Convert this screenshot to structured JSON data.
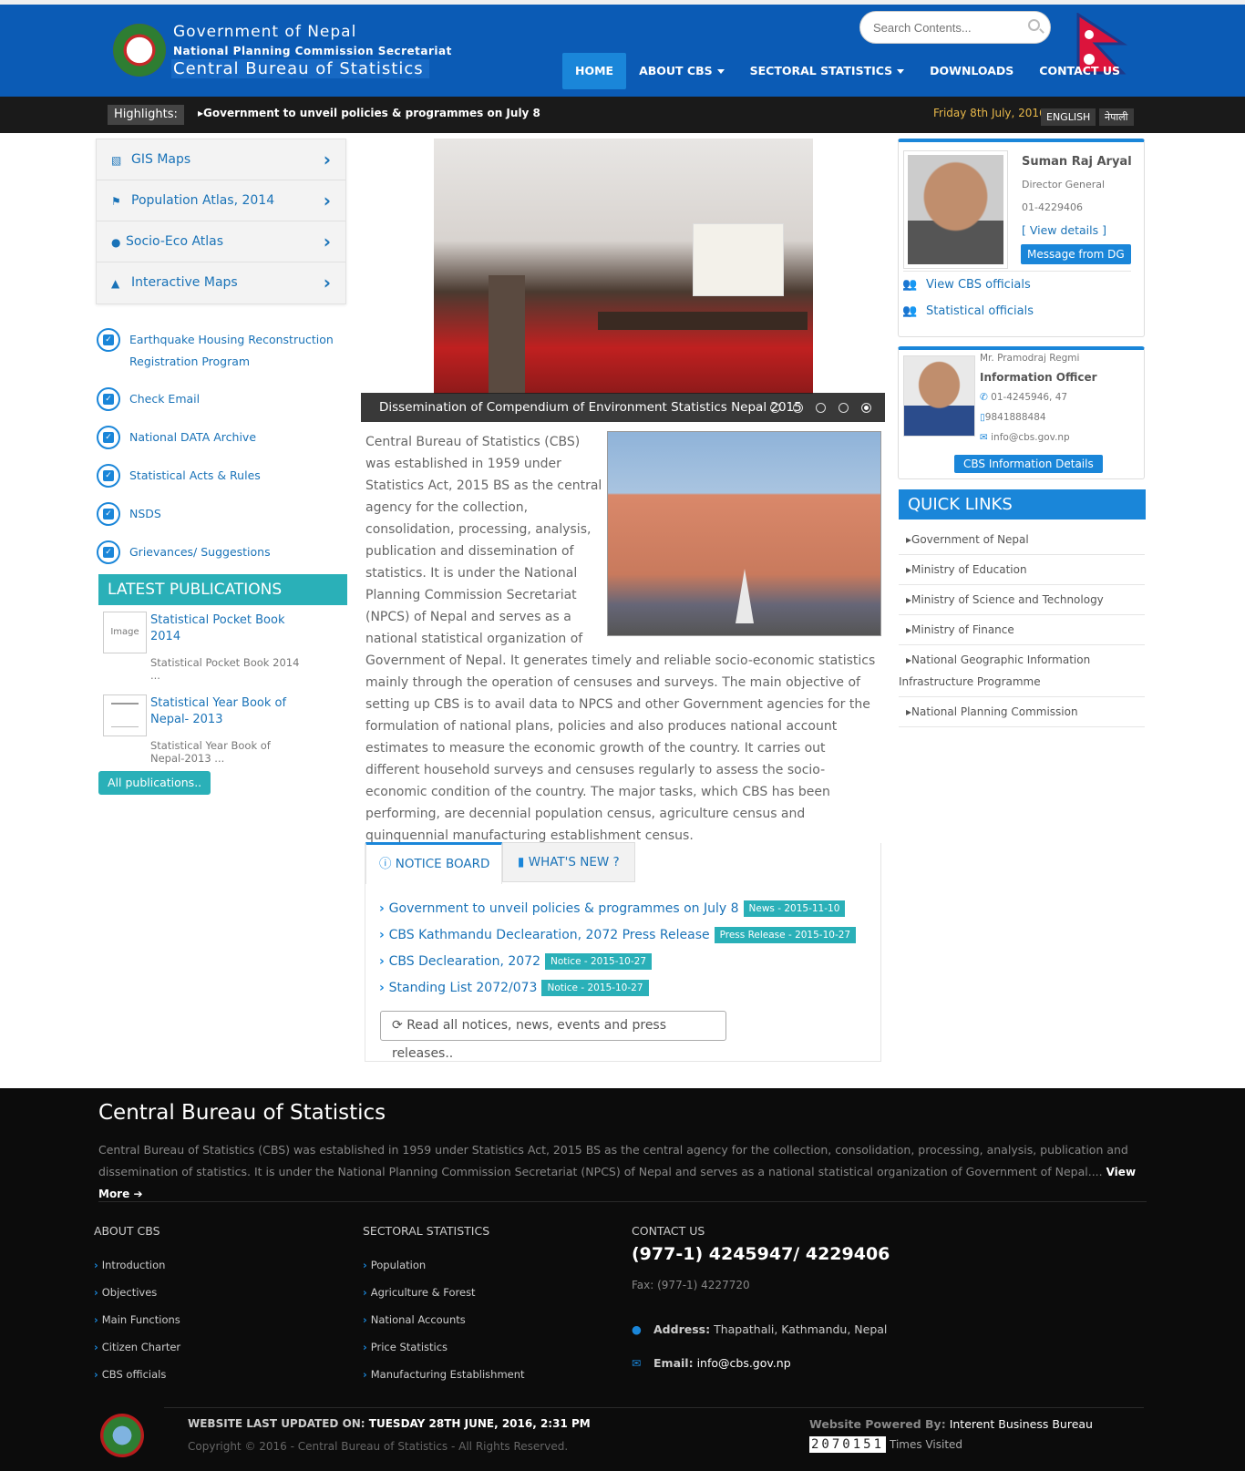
{
  "header": {
    "title_line1": "Government of Nepal",
    "title_line2": "National Planning Commission Secretariat",
    "title_line3": "Central Bureau of Statistics",
    "search_placeholder": "Search Contents...",
    "nav": [
      {
        "label": "HOME",
        "active": true
      },
      {
        "label": "ABOUT CBS",
        "dropdown": true
      },
      {
        "label": "SECTORAL STATISTICS",
        "dropdown": true
      },
      {
        "label": "DOWNLOADS"
      },
      {
        "label": "CONTACT US"
      }
    ]
  },
  "highlights": {
    "label": "Highlights:",
    "text": "Government to unveil policies & programmes on July 8",
    "date": "Friday 8th July, 2016",
    "lang_en": "ENGLISH",
    "lang_np": "नेपाली"
  },
  "left_menu": [
    {
      "label": "GIS Maps",
      "icon": "image-icon"
    },
    {
      "label": "Population Atlas, 2014",
      "icon": "flag-icon"
    },
    {
      "label": "Socio-Eco Atlas",
      "icon": "map-marker-icon"
    },
    {
      "label": "Interactive Maps",
      "icon": "area-chart-icon"
    }
  ],
  "left_links": [
    "Earthquake Housing Reconstruction Registration Program",
    "Check Email",
    "National DATA Archive",
    "Statistical Acts & Rules",
    "NSDS",
    "Grievances/ Suggestions"
  ],
  "publications": {
    "heading": "LATEST PUBLICATIONS",
    "items": [
      {
        "thumb": "Image",
        "title": "Statistical Pocket Book 2014",
        "desc": "Statistical Pocket Book 2014 ..."
      },
      {
        "thumb": "",
        "title": "Statistical Year Book of Nepal- 2013",
        "desc": "Statistical Year Book of Nepal-2013 ..."
      }
    ],
    "all_label": "All publications.."
  },
  "slider": {
    "caption": "Dissemination of Compendium of Environment Statistics Nepal 2015",
    "dot_count": 5,
    "active_dot": 4
  },
  "about_text": "Central Bureau of Statistics (CBS) was established in 1959 under Statistics Act, 2015 BS as the central agency for the collection, consolidation, processing, analysis, publication and dissemination of statistics. It is under the National Planning Commission Secretariat (NPCS) of Nepal and serves as a national statistical organization of Government of Nepal. It generates timely and reliable socio-economic statistics mainly through the operation of censuses and surveys. The main objective of setting up CBS is to avail data to NPCS and other Government agencies for the formulation of national plans, policies and also produces national account estimates to measure the economic growth of the country. It carries out different household surveys and censuses regularly to assess the socio- economic condition of the country. The major tasks, which CBS has been performing, are decennial population census, agriculture census and quinquennial manufacturing establishment census.",
  "tabs": {
    "notice_board": "NOTICE BOARD",
    "whats_new": "WHAT'S NEW ?",
    "notices": [
      {
        "title": "Government to unveil policies & programmes on July 8",
        "badge": "News - 2015-11-10"
      },
      {
        "title": "CBS Kathmandu Declearation, 2072 Press Release",
        "badge": "Press Release - 2015-10-27"
      },
      {
        "title": "CBS Declearation, 2072",
        "badge": "Notice - 2015-10-27"
      },
      {
        "title": "Standing List 2072/073",
        "badge": "Notice - 2015-10-27"
      }
    ],
    "read_all": "Read all notices, news, events and press releases.."
  },
  "dg": {
    "name": "Suman Raj Aryal",
    "title": "Director General",
    "phone": "01-4229406",
    "view_details": "[ View details ]",
    "message_btn": "Message from DG",
    "view_officials": "View CBS officials",
    "stat_officials": "Statistical officials"
  },
  "info_officer": {
    "name": "Mr. Pramodraj Regmi",
    "title": "Information Officer",
    "phone": "01-4245946, 47",
    "mobile": "9841888484",
    "email": "info@cbs.gov.np",
    "details_btn": "CBS Information Details"
  },
  "quick_links": {
    "heading": "QUICK LINKS",
    "items": [
      "Government of Nepal",
      "Ministry of Education",
      "Ministry of Science and Technology",
      "Ministry of Finance",
      "National Geographic Information Infrastructure Programme",
      "National Planning Commission"
    ]
  },
  "footer": {
    "title": "Central Bureau of Statistics",
    "desc": "Central Bureau of Statistics (CBS) was established in 1959 under Statistics Act, 2015 BS as the central agency for the collection, consolidation, processing, analysis, publication and dissemination of statistics. It is under the National Planning Commission Secretariat (NPCS) of Nepal and serves as a national statistical organization of Government of Nepal....",
    "view_more": "View More",
    "about_head": "ABOUT CBS",
    "about_links": [
      "Introduction",
      "Objectives",
      "Main Functions",
      "Citizen Charter",
      "CBS officials"
    ],
    "sectoral_head": "SECTORAL STATISTICS",
    "sectoral_links": [
      "Population",
      "Agriculture & Forest",
      "National Accounts",
      "Price Statistics",
      "Manufacturing Establishment"
    ],
    "contact_head": "CONTACT US",
    "phone": "(977-1) 4245947/ 4229406",
    "fax": "Fax: (977-1) 4227720",
    "address_label": "Address:",
    "address": "Thapathali, Kathmandu, Nepal",
    "email_label": "Email:",
    "email": "info@cbs.gov.np",
    "updated_label": "WEBSITE LAST UPDATED ON:",
    "updated": "TUESDAY 28TH JUNE, 2016, 2:31 PM",
    "copyright": "Copyright © 2016 - Central Bureau of Statistics - All Rights Reserved.",
    "powered_label": "Website Powered By:",
    "powered": "Interent Business Bureau",
    "counter": "2070151",
    "visits": "Times Visited"
  }
}
